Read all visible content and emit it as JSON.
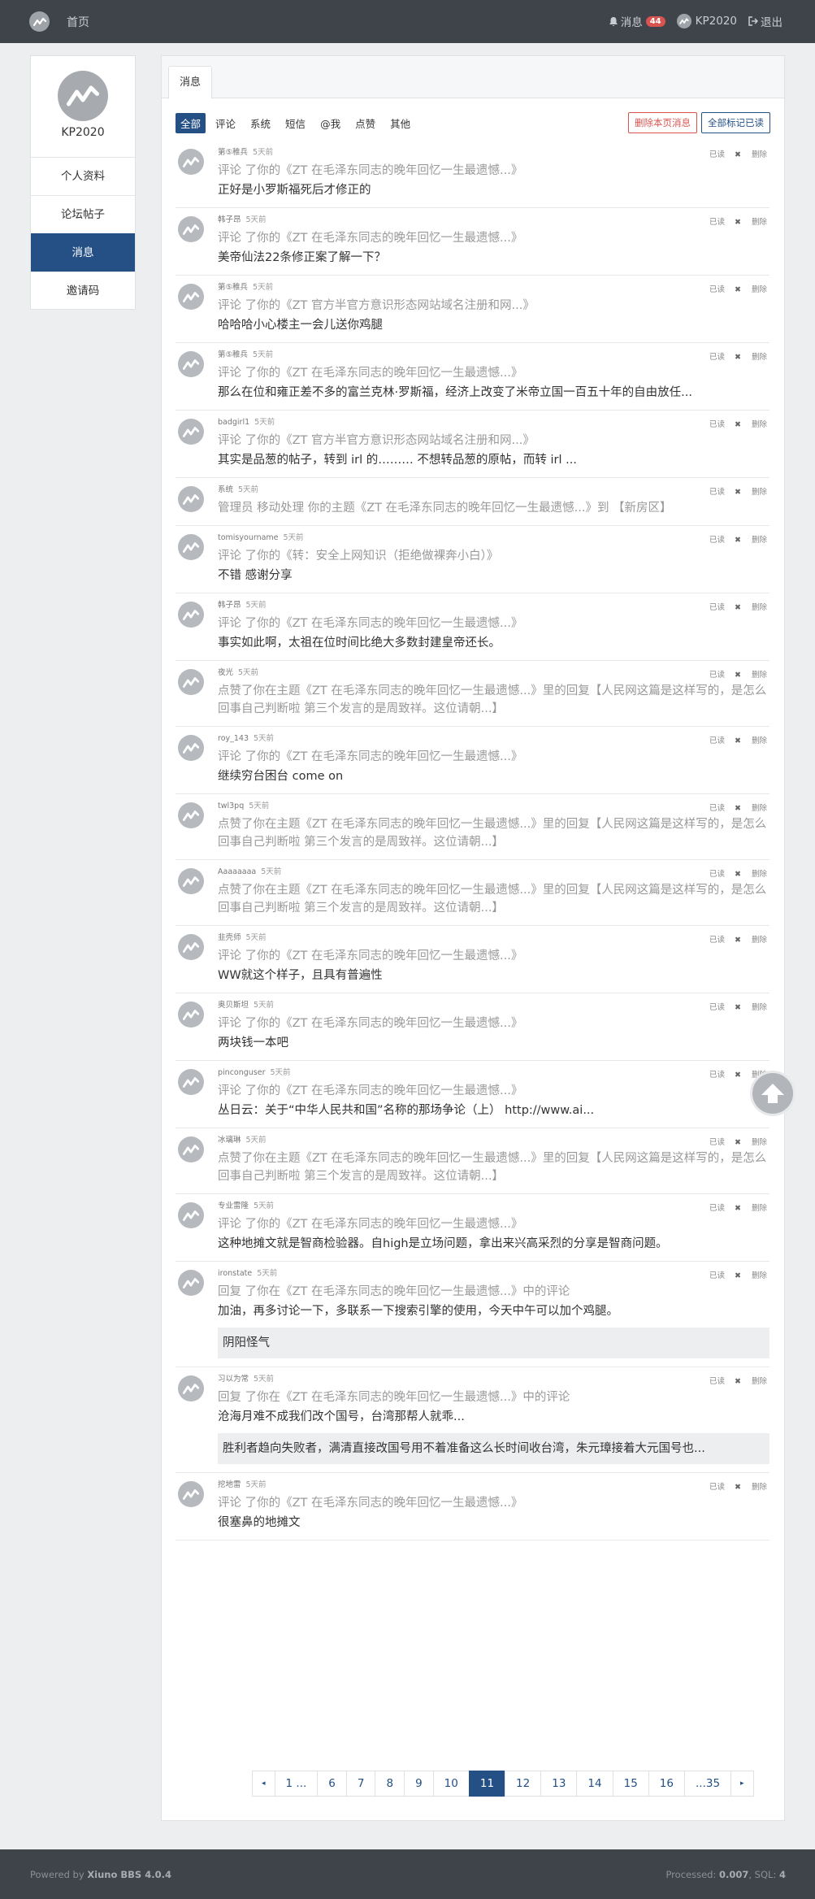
{
  "nav": {
    "home_label": "首页",
    "messages_label": "消息",
    "messages_count": "44",
    "user_label": "KP2020",
    "logout_label": "退出"
  },
  "sidebar": {
    "username": "KP2020",
    "items": [
      {
        "label": "个人资料"
      },
      {
        "label": "论坛帖子"
      },
      {
        "label": "消息"
      },
      {
        "label": "邀请码"
      }
    ]
  },
  "main": {
    "tab_label": "消息",
    "filters": [
      "全部",
      "评论",
      "系统",
      "短信",
      "@我",
      "点赞",
      "其他"
    ],
    "delete_page_label": "删除本页消息",
    "mark_all_read_label": "全部标记已读",
    "read_label": "已读",
    "delete_label": "删除"
  },
  "messages": [
    {
      "user": "第⑤稚兵",
      "time": "5天前",
      "sub": "评论 了你的《ZT 在毛泽东同志的晚年回忆一生最遗憾...》",
      "body": "正好是小罗斯福死后才修正的"
    },
    {
      "user": "韩子昂",
      "time": "5天前",
      "sub": "评论 了你的《ZT 在毛泽东同志的晚年回忆一生最遗憾...》",
      "body": "美帝仙法22条修正案了解一下？"
    },
    {
      "user": "第⑤稚兵",
      "time": "5天前",
      "sub": "评论 了你的《ZT 官方半官方意识形态网站域名注册和网...》",
      "body": "哈哈哈小心楼主一会儿送你鸡腿"
    },
    {
      "user": "第⑤稚兵",
      "time": "5天前",
      "sub": "评论 了你的《ZT 在毛泽东同志的晚年回忆一生最遗憾...》",
      "body": "那么在位和雍正差不多的富兰克林·罗斯福，经济上改变了米帝立国一百五十年的自由放任..."
    },
    {
      "user": "badgirl1",
      "time": "5天前",
      "sub": "评论 了你的《ZT 官方半官方意识形态网站域名注册和网...》",
      "body": "其实是品葱的帖子，转到 irl 的……… 不想转品葱的原帖，而转 irl ..."
    },
    {
      "user": "系统",
      "time": "5天前",
      "sub": "管理员 移动处理 你的主题《ZT 在毛泽东同志的晚年回忆一生最遗憾...》到 【新房区】",
      "body": ""
    },
    {
      "user": "tomisyourname",
      "time": "5天前",
      "sub": "评论 了你的《转：安全上网知识（拒绝做裸奔小白）》",
      "body": "不错 感谢分享"
    },
    {
      "user": "韩子昂",
      "time": "5天前",
      "sub": "评论 了你的《ZT 在毛泽东同志的晚年回忆一生最遗憾...》",
      "body": "事实如此啊，太祖在位时间比绝大多数封建皇帝还长。"
    },
    {
      "user": "夜光",
      "time": "5天前",
      "sub": "点赞了你在主题《ZT 在毛泽东同志的晚年回忆一生最遗憾...》里的回复【人民网这篇是这样写的，是怎么回事自己判断啦 第三个发言的是周致祥。这位请朝...】",
      "body": ""
    },
    {
      "user": "roy_143",
      "time": "5天前",
      "sub": "评论 了你的《ZT 在毛泽东同志的晚年回忆一生最遗憾...》",
      "body": "继续穷台困台 come on"
    },
    {
      "user": "twl3pq",
      "time": "5天前",
      "sub": "点赞了你在主题《ZT 在毛泽东同志的晚年回忆一生最遗憾...》里的回复【人民网这篇是这样写的，是怎么回事自己判断啦 第三个发言的是周致祥。这位请朝...】",
      "body": ""
    },
    {
      "user": "Aaaaaaaa",
      "time": "5天前",
      "sub": "点赞了你在主题《ZT 在毛泽东同志的晚年回忆一生最遗憾...》里的回复【人民网这篇是这样写的，是怎么回事自己判断啦 第三个发言的是周致祥。这位请朝...】",
      "body": ""
    },
    {
      "user": "韭壳师",
      "time": "5天前",
      "sub": "评论 了你的《ZT 在毛泽东同志的晚年回忆一生最遗憾...》",
      "body": "WW就这个样子，且具有普遍性"
    },
    {
      "user": "奥贝斯坦",
      "time": "5天前",
      "sub": "评论 了你的《ZT 在毛泽东同志的晚年回忆一生最遗憾...》",
      "body": "两块钱一本吧"
    },
    {
      "user": "pinconguser",
      "time": "5天前",
      "sub": "评论 了你的《ZT 在毛泽东同志的晚年回忆一生最遗憾...》",
      "body": "丛日云：关于“中华人民共和国”名称的那场争论（上） http://www.ai..."
    },
    {
      "user": "冰璃琳",
      "time": "5天前",
      "sub": "点赞了你在主题《ZT 在毛泽东同志的晚年回忆一生最遗憾...》里的回复【人民网这篇是这样写的，是怎么回事自己判断啦 第三个发言的是周致祥。这位请朝...】",
      "body": ""
    },
    {
      "user": "专业雷隆",
      "time": "5天前",
      "sub": "评论 了你的《ZT 在毛泽东同志的晚年回忆一生最遗憾...》",
      "body": "这种地摊文就是智商检验器。自high是立场问题，拿出来兴高采烈的分享是智商问题。"
    },
    {
      "user": "ironstate",
      "time": "5天前",
      "sub": "回复 了你在《ZT 在毛泽东同志的晚年回忆一生最遗憾...》中的评论",
      "body": "加油，再多讨论一下，多联系一下搜索引擎的使用，今天中午可以加个鸡腿。",
      "quote": "阴阳怪气"
    },
    {
      "user": "习以为常",
      "time": "5天前",
      "sub": "回复 了你在《ZT 在毛泽东同志的晚年回忆一生最遗憾...》中的评论",
      "body": "沧海月难不成我们改个国号，台湾那帮人就乖...",
      "quote": "胜利者趋向失败者，满清直接改国号用不着准备这么长时间收台湾，朱元璋接着大元国号也..."
    },
    {
      "user": "挖地雷",
      "time": "5天前",
      "sub": "评论 了你的《ZT 在毛泽东同志的晚年回忆一生最遗憾...》",
      "body": "很塞鼻的地摊文"
    }
  ],
  "pagination": [
    "◂",
    "1 ...",
    "6",
    "7",
    "8",
    "9",
    "10",
    "11",
    "12",
    "13",
    "14",
    "15",
    "16",
    "...35",
    "▸"
  ],
  "pagination_current": "11",
  "footer": {
    "powered_prefix": "Powered by",
    "powered_name": "Xiuno BBS 4.0.4",
    "processed_prefix": "Processed:",
    "processed_value": "0.007",
    "sql_prefix": ", SQL:",
    "sql_value": "4"
  }
}
